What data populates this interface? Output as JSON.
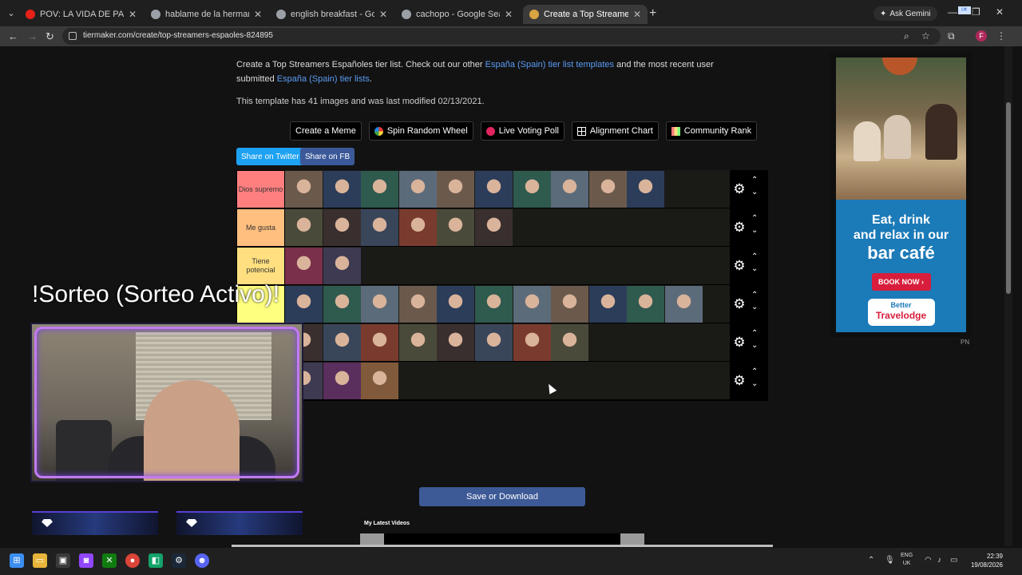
{
  "browser": {
    "tabs": [
      {
        "title": "POV: LA VIDA DE PABLO CON I",
        "favicon_color": "#e62117",
        "active": false
      },
      {
        "title": "hablame de la hermandad mus",
        "favicon_color": "#9aa0a6",
        "active": false
      },
      {
        "title": "english breakfast - Google Sea",
        "favicon_color": "#9aa0a6",
        "active": false
      },
      {
        "title": "cachopo - Google Search",
        "favicon_color": "#9aa0a6",
        "active": false
      },
      {
        "title": "Create a Top Streamers Españo",
        "favicon_color": "#d9a441",
        "active": true
      }
    ],
    "gemini_label": "Ask Gemini",
    "url": "tiermaker.com/create/top-streamers-espaoles-824895",
    "profile_initial": "F"
  },
  "page": {
    "description_prefix": "Create a Top Streamers Españoles tier list. Check out our other ",
    "link_templates": "España (Spain) tier list templates",
    "description_middle": " and the most recent user submitted ",
    "link_lists": "España (Spain) tier lists",
    "description_suffix": ".",
    "meta": "This template has 41 images and was last modified 02/13/2021.",
    "buttons": [
      {
        "label": "Create a Meme",
        "icon": "none"
      },
      {
        "label": "Spin Random Wheel",
        "icon": "wheel-icon"
      },
      {
        "label": "Live Voting Poll",
        "icon": "record-icon"
      },
      {
        "label": "Alignment Chart",
        "icon": "grid-icon"
      },
      {
        "label": "Community Rank",
        "icon": "rank-icon"
      }
    ],
    "share_twitter": "Share on Twitter",
    "share_fb": "Share on FB",
    "save_label": "Save or Download",
    "videos_title": "My Latest Videos"
  },
  "tiers": [
    {
      "label": "Dios supremo",
      "color": "#ff7f7f",
      "count": 10
    },
    {
      "label": "Me gusta",
      "color": "#ffbf7f",
      "count": 6
    },
    {
      "label": "Tiene potencial",
      "color": "#ffdf7f",
      "count": 2
    },
    {
      "label": "",
      "color": "#ffff7f",
      "count": 11
    },
    {
      "label": "",
      "color": "#bfff7f",
      "count": 8
    },
    {
      "label": "",
      "color": "#7fff7f",
      "count": 3
    }
  ],
  "stream_overlay": {
    "sorteo_text": "!Sorteo (Sorteo Activo)!"
  },
  "ad": {
    "line1": "Eat, drink",
    "line2": "and relax in our",
    "line3": "bar café",
    "cta": "BOOK NOW ›",
    "brand_top": "Better",
    "brand_bottom": "Travelodge",
    "badge": "PN"
  },
  "taskbar": {
    "lang_top": "ENG",
    "lang_bottom": "UK",
    "time": "22:39",
    "date": "19/08/2026"
  }
}
